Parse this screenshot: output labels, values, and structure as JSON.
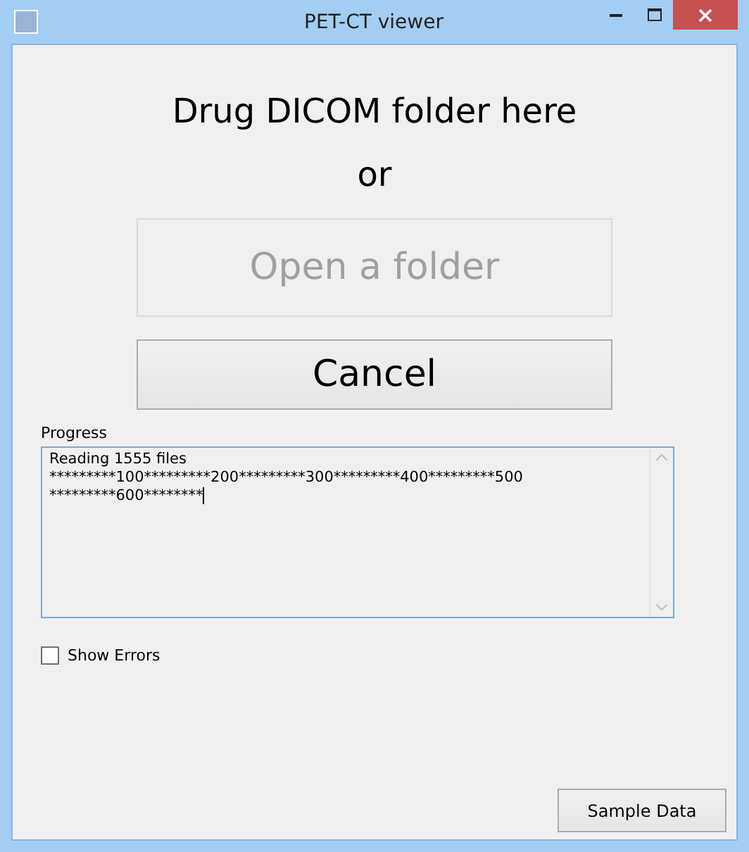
{
  "window": {
    "title": "PET-CT viewer"
  },
  "drop_hint": "Drug DICOM folder here",
  "or_label": "or",
  "buttons": [
    {
      "label": "Open a folder",
      "disabled": true
    },
    {
      "label": "Cancel",
      "disabled": false
    }
  ],
  "progress": {
    "label": "Progress",
    "lines": [
      "Reading 1555 files",
      "*********100*********200*********300*********400*********500",
      "*********600********"
    ]
  },
  "show_errors": {
    "label": "Show Errors",
    "checked": false
  },
  "sample_button": {
    "label": "Sample Data"
  }
}
